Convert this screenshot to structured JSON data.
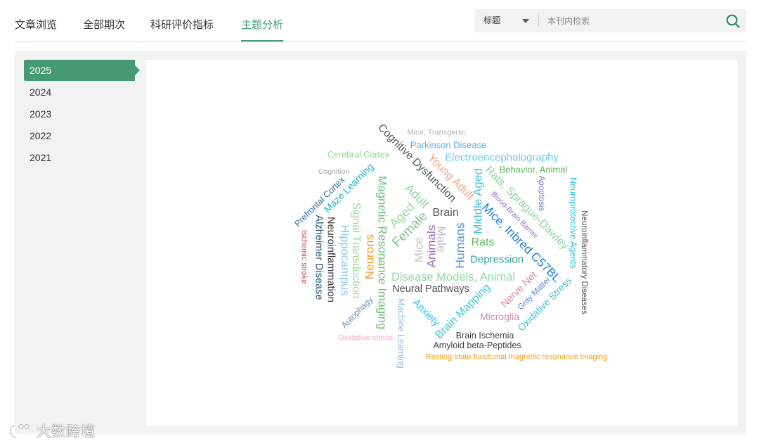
{
  "nav": {
    "tabs": [
      {
        "label": "文章浏览",
        "active": false
      },
      {
        "label": "全部期次",
        "active": false
      },
      {
        "label": "科研评价指标",
        "active": false
      },
      {
        "label": "主题分析",
        "active": true
      }
    ]
  },
  "search": {
    "field_select": "标题",
    "placeholder": "本刊内检索",
    "value": "",
    "icon": "search-icon"
  },
  "sidebar": {
    "years": [
      {
        "label": "2025",
        "active": true
      },
      {
        "label": "2024",
        "active": false
      },
      {
        "label": "2023",
        "active": false
      },
      {
        "label": "2022",
        "active": false
      },
      {
        "label": "2021",
        "active": false
      }
    ]
  },
  "word_cloud": {
    "words": [
      {
        "text": "Mice, Transgenic",
        "color": "#b3b3b3"
      },
      {
        "text": "Parkinson Disease",
        "color": "#5dade2"
      },
      {
        "text": "Cognitive Dysfunction",
        "color": "#555555"
      },
      {
        "text": "Cerebral Cortex",
        "color": "#86d98e"
      },
      {
        "text": "Electroencephalography",
        "color": "#6ec6ea"
      },
      {
        "text": "Young Adult",
        "color": "#f4a582"
      },
      {
        "text": "Cognition",
        "color": "#aaaaaa"
      },
      {
        "text": "Maze Learning",
        "color": "#1fb5c4"
      },
      {
        "text": "Behavior, Animal",
        "color": "#5cb85c"
      },
      {
        "text": "Rats, Sprague-Dawley",
        "color": "#8fd59a"
      },
      {
        "text": "Middle Aged",
        "color": "#45c1d8"
      },
      {
        "text": "Apoptosis",
        "color": "#6a7fc9"
      },
      {
        "text": "Neuroprotective Agents",
        "color": "#2ec4db"
      },
      {
        "text": "Neuroinflammatory Diseases",
        "color": "#555555"
      },
      {
        "text": "Magnetic Resonance Imaging",
        "color": "#6cc070"
      },
      {
        "text": "Prefrontal Cortex",
        "color": "#2d6fa8"
      },
      {
        "text": "Adult",
        "color": "#8fd59a"
      },
      {
        "text": "Aged",
        "color": "#9fd8a0"
      },
      {
        "text": "Blood-Brain Barrier",
        "color": "#8e6fd1"
      },
      {
        "text": "Brain",
        "color": "#555555"
      },
      {
        "text": "Signal Transduction",
        "color": "#9fd8a0"
      },
      {
        "text": "Female",
        "color": "#7cc47f"
      },
      {
        "text": "Mice, Inbred C57BL",
        "color": "#1e7fd6"
      },
      {
        "text": "Alzheimer Disease",
        "color": "#1f4f7a"
      },
      {
        "text": "Neuroinflammation",
        "color": "#333333"
      },
      {
        "text": "Hippocampus",
        "color": "#8cc7ec"
      },
      {
        "text": "Ischemic stroke",
        "color": "#c0504d"
      },
      {
        "text": "Male",
        "color": "#bdbdbd"
      },
      {
        "text": "Animals",
        "color": "#9a6bb8"
      },
      {
        "text": "Mice",
        "color": "#c4c4c4"
      },
      {
        "text": "Humans",
        "color": "#5b93cf"
      },
      {
        "text": "Rats",
        "color": "#5cb85c"
      },
      {
        "text": "Neurons",
        "color": "#ef9a1a"
      },
      {
        "text": "Depression",
        "color": "#26a69a"
      },
      {
        "text": "Disease Models, Animal",
        "color": "#92d9a4"
      },
      {
        "text": "Neural Pathways",
        "color": "#555555"
      },
      {
        "text": "Nerve Net",
        "color": "#d98aa8"
      },
      {
        "text": "Gray Matter",
        "color": "#4f86d8"
      },
      {
        "text": "Oxidative Stress",
        "color": "#3fc1d6"
      },
      {
        "text": "Autophagy",
        "color": "#6a8fb8"
      },
      {
        "text": "Machine Learning",
        "color": "#91b9e2"
      },
      {
        "text": "Anxiety",
        "color": "#2ec4db"
      },
      {
        "text": "Brain Mapping",
        "color": "#45c1d8"
      },
      {
        "text": "Microglia",
        "color": "#c98fb4"
      },
      {
        "text": "Oxidative stress",
        "color": "#f4a9bd"
      },
      {
        "text": "Brain Ischemia",
        "color": "#444444"
      },
      {
        "text": "Amyloid beta-Peptides",
        "color": "#444444"
      },
      {
        "text": "Resting-state functional magnetic resonance imaging",
        "color": "#f39c12"
      }
    ]
  },
  "watermark": {
    "text": "大数跨境",
    "icon": "watermark-logo-icon"
  },
  "colors": {
    "accent": "#459a74",
    "search_icon": "#2f8a5c"
  }
}
